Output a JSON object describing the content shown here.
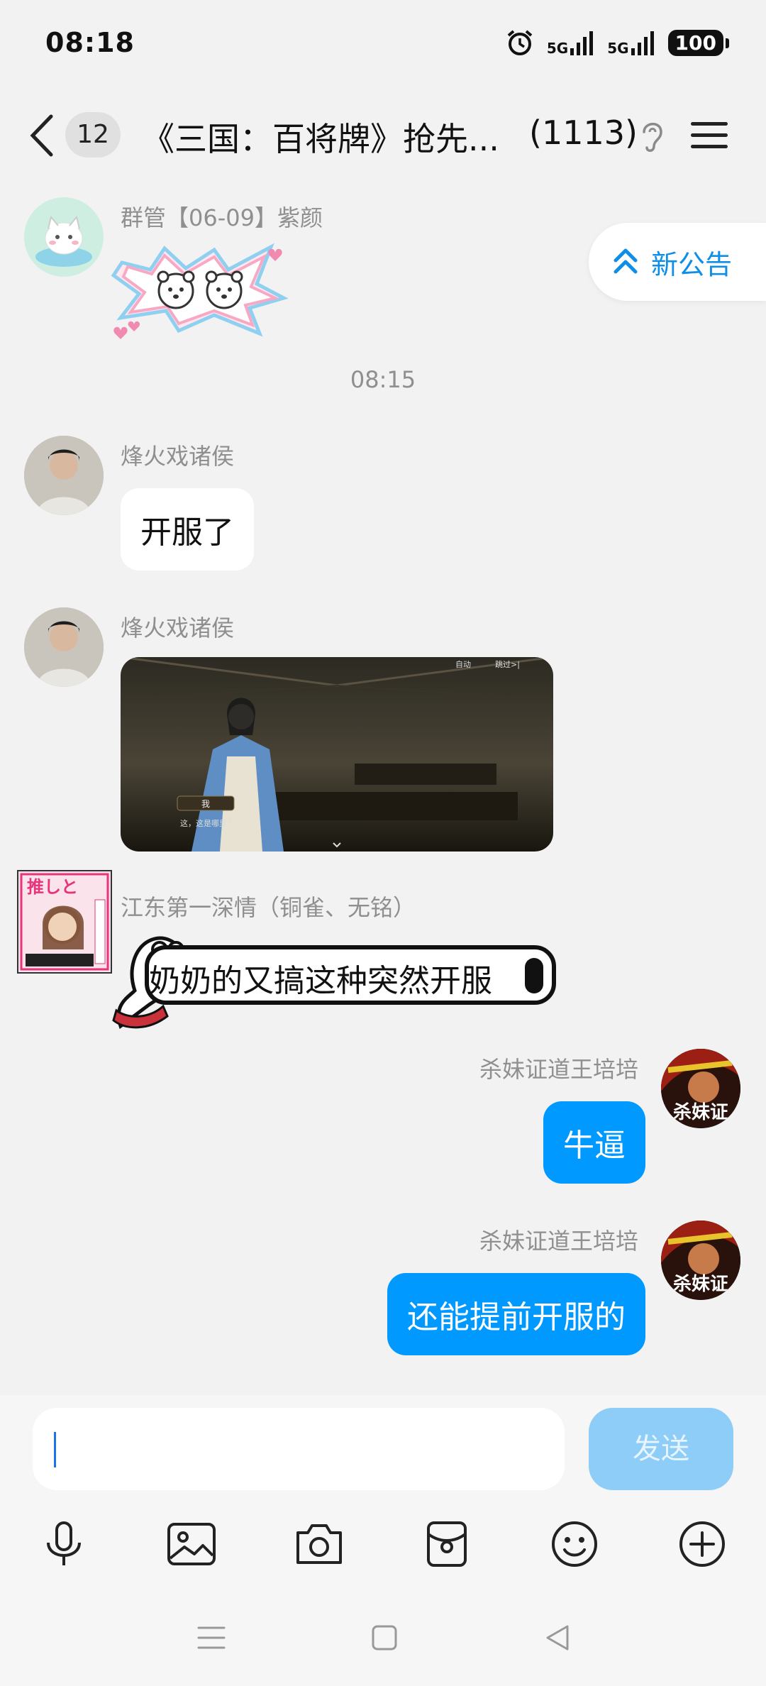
{
  "status": {
    "time": "08:18",
    "signal1": "5G",
    "signal2": "5G",
    "battery": "100"
  },
  "header": {
    "unread_count": "12",
    "title": "《三国：百将牌》抢先...",
    "member_count": "(1113)"
  },
  "notice": {
    "label": "新公告"
  },
  "messages": [
    {
      "sender": "群管【06-09】紫颜",
      "type": "sticker"
    },
    {
      "sender": "烽火戏诸侯",
      "text": "开服了"
    },
    {
      "sender": "烽火戏诸侯",
      "type": "image",
      "image_ui": {
        "auto": "自动",
        "skip": "跳过>|",
        "name_tag": "我",
        "dialog": "这，这是哪里？"
      }
    },
    {
      "sender": "江东第一深情（铜雀、无铭）",
      "text": "奶奶的又搞这种突然开服"
    },
    {
      "sender": "杀妹证道王培培",
      "text": "牛逼"
    },
    {
      "sender": "杀妹证道王培培",
      "text": "还能提前开服的"
    }
  ],
  "timestamp": "08:15",
  "avatar_texts": {
    "jiangdong": "推しと",
    "wang": "杀妹证"
  },
  "input": {
    "placeholder": "",
    "send_label": "发送"
  },
  "colors": {
    "accent": "#0099ff",
    "send_disabled": "#8ecdf7",
    "notice": "#0d8ee8"
  }
}
